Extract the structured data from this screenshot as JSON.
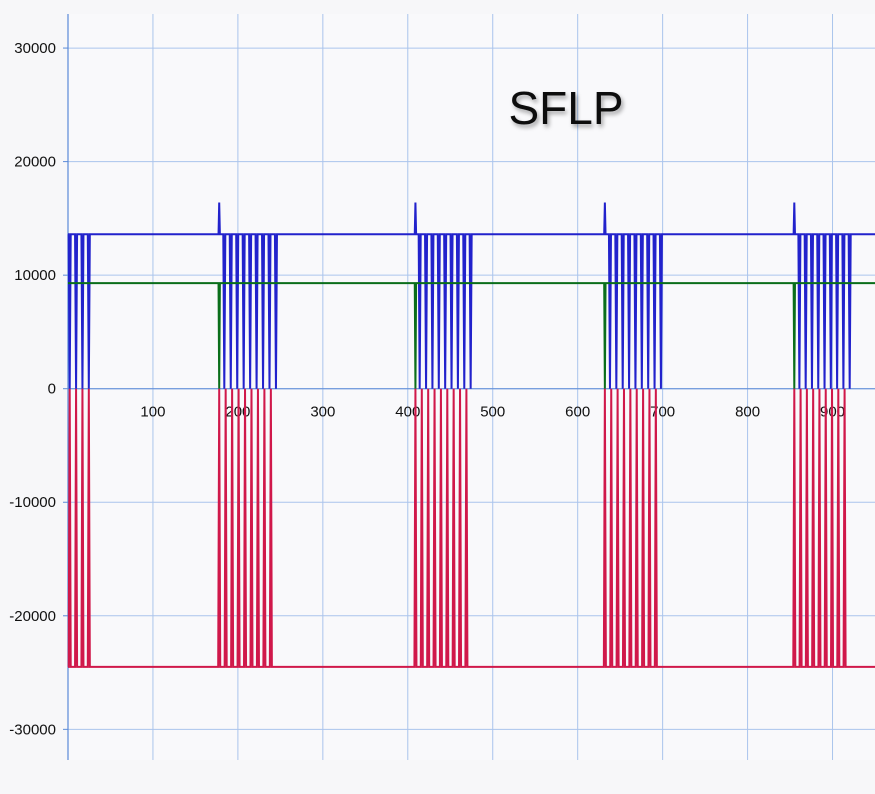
{
  "chart_data": {
    "type": "line",
    "title": "SFLP",
    "xlabel": "",
    "ylabel": "",
    "xlim": [
      0,
      950
    ],
    "ylim": [
      -32700,
      33000
    ],
    "x_ticks": [
      100,
      200,
      300,
      400,
      500,
      600,
      700,
      800,
      900
    ],
    "y_ticks": [
      -30000,
      -20000,
      -10000,
      0,
      10000,
      20000,
      30000
    ],
    "grid": true,
    "legend": "none",
    "colors": {
      "blue": "#2222cc",
      "green": "#0a6e1a",
      "red": "#d0184a",
      "grid": "#aac4ec",
      "axis": "#5a8ad8"
    },
    "series": [
      {
        "color": "blue",
        "baseline": 13600,
        "spikes": [
          {
            "x": 178,
            "y": 16400
          },
          {
            "x": 409,
            "y": 16400
          },
          {
            "x": 632,
            "y": 16400
          },
          {
            "x": 855,
            "y": 16400
          }
        ],
        "pulse_groups": [
          {
            "start": 2,
            "count": 4,
            "period": 7.5,
            "low": 0
          },
          {
            "start": 184,
            "count": 9,
            "period": 7.6,
            "low": 0
          },
          {
            "start": 414,
            "count": 9,
            "period": 7.5,
            "low": 0
          },
          {
            "start": 638,
            "count": 9,
            "period": 7.5,
            "low": 0
          },
          {
            "start": 861,
            "count": 9,
            "period": 7.4,
            "low": 0
          }
        ]
      },
      {
        "color": "green",
        "baseline": 9300,
        "drops": [
          {
            "x": 178,
            "y": 0
          },
          {
            "x": 409,
            "y": 0
          },
          {
            "x": 632,
            "y": 0
          },
          {
            "x": 855,
            "y": 0
          }
        ]
      },
      {
        "color": "red",
        "baseline": -24500,
        "pulse_groups": [
          {
            "start": 2,
            "count": 4,
            "period": 7.5,
            "high": 0
          },
          {
            "start": 178,
            "count": 9,
            "period": 7.6,
            "high": 0
          },
          {
            "start": 409,
            "count": 9,
            "period": 7.5,
            "high": 0
          },
          {
            "start": 632,
            "count": 9,
            "period": 7.5,
            "high": 0
          },
          {
            "start": 855,
            "count": 9,
            "period": 7.4,
            "high": 0
          }
        ]
      }
    ]
  }
}
